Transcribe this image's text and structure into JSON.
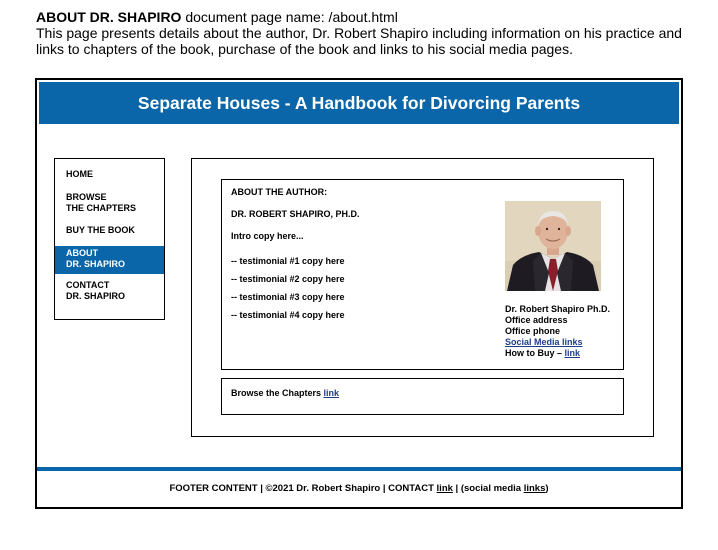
{
  "note": {
    "title": "ABOUT DR. SHAPIRO",
    "subtitle": " document page name: /about.html",
    "description": "This page presents details about the author, Dr. Robert Shapiro including information on his practice and links to chapters of the book, purchase of the book and links to his social media pages."
  },
  "banner": {
    "title": "Separate Houses - A Handbook for Divorcing Parents"
  },
  "nav": {
    "items": [
      {
        "line1": "HOME",
        "line2": ""
      },
      {
        "line1": "BROWSE",
        "line2": "THE CHAPTERS"
      },
      {
        "line1": "BUY THE BOOK",
        "line2": ""
      },
      {
        "line1": "ABOUT",
        "line2": "DR. SHAPIRO"
      },
      {
        "line1": "CONTACT",
        "line2": "DR. SHAPIRO"
      }
    ]
  },
  "about": {
    "heading": "ABOUT THE AUTHOR:",
    "name": "DR. ROBERT SHAPIRO, PH.D.",
    "intro": "Intro copy here...",
    "testimonials": [
      "-- testimonial #1 copy here",
      "-- testimonial #2 copy here",
      "-- testimonial #3 copy here",
      "-- testimonial #4 copy here"
    ],
    "contact": {
      "name": "Dr. Robert Shapiro Ph.D.",
      "address": "Office address",
      "phone": "Office phone",
      "social": "Social Media links ",
      "buy_label": "How to Buy – ",
      "buy_link": "link "
    }
  },
  "browse": {
    "label": "Browse the Chapters ",
    "link": "link "
  },
  "footer": {
    "part1": "FOOTER CONTENT  |  ©2021 Dr. Robert Shapiro  |  CONTACT ",
    "contact_link": "link",
    "part2": "  |     (social media ",
    "social_link": "links",
    "part3": ")"
  },
  "colors": {
    "brand_blue": "#0a66a8",
    "link_blue": "#1f3d8c"
  }
}
